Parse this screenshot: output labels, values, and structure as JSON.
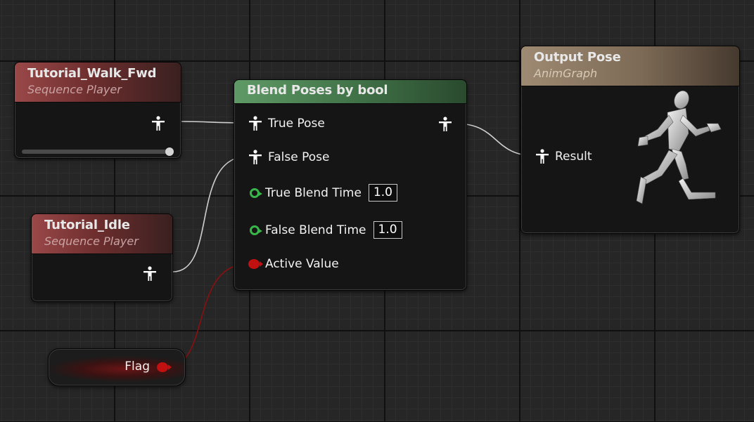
{
  "graph": {
    "nodes": {
      "walk": {
        "title": "Tutorial_Walk_Fwd",
        "subtitle": "Sequence Player",
        "playback_position": 1.0
      },
      "idle": {
        "title": "Tutorial_Idle",
        "subtitle": "Sequence Player"
      },
      "blend": {
        "title": "Blend Poses by bool",
        "pins": {
          "true_pose": "True Pose",
          "false_pose": "False Pose",
          "true_blend_time": "True Blend Time",
          "true_blend_value": "1.0",
          "false_blend_time": "False Blend Time",
          "false_blend_value": "1.0",
          "active_value": "Active Value"
        }
      },
      "output": {
        "title": "Output Pose",
        "subtitle": "AnimGraph",
        "result_label": "Result"
      },
      "flag": {
        "label": "Flag"
      }
    },
    "colors": {
      "pose_wire": "#d8d8d8",
      "bool_wire": "#8a1010",
      "exec_pin": "#39b54a",
      "bool_pin": "#c01010"
    },
    "icons": [
      "pose-pin-icon",
      "blend-time-pin-icon",
      "bool-pin-icon",
      "mannequin-figure-icon"
    ]
  }
}
